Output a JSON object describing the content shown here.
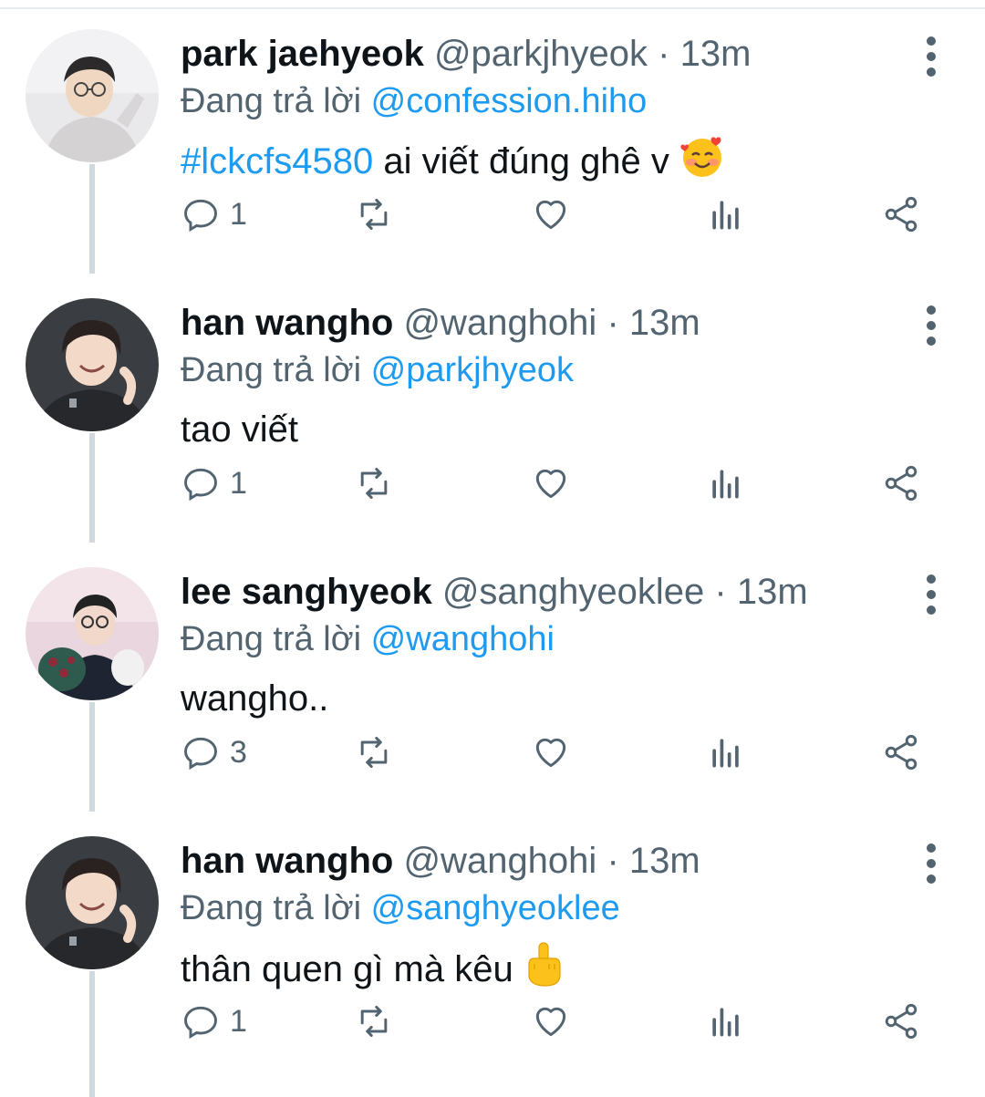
{
  "reply_prefix": "Đang trả lời",
  "tweets": [
    {
      "name": "park jaehyeok",
      "handle": "@parkjhyeok",
      "dot": "·",
      "time": "13m",
      "reply_to": "@confession.hiho",
      "hashtag": "#lckcfs4580",
      "text": "ai viết đúng ghê v",
      "emoji": "smiling-face-with-hearts",
      "reply_count": "1"
    },
    {
      "name": "han wangho",
      "handle": "@wanghohi",
      "dot": "·",
      "time": "13m",
      "reply_to": "@parkjhyeok",
      "text": "tao viết",
      "reply_count": "1"
    },
    {
      "name": "lee sanghyeok",
      "handle": "@sanghyeoklee",
      "dot": "·",
      "time": "13m",
      "reply_to": "@wanghohi",
      "text": "wangho..",
      "reply_count": "3"
    },
    {
      "name": "han wangho",
      "handle": "@wanghohi",
      "dot": "·",
      "time": "13m",
      "reply_to": "@sanghyeoklee",
      "text": "thân quen gì mà kêu",
      "emoji": "middle-finger",
      "reply_count": "1"
    }
  ],
  "colors": {
    "link": "#1d9bf0",
    "secondary": "#536471",
    "thread_line": "#cfd9de"
  },
  "icons": [
    "reply-icon",
    "retweet-icon",
    "like-icon",
    "views-icon",
    "share-icon",
    "more-icon"
  ]
}
